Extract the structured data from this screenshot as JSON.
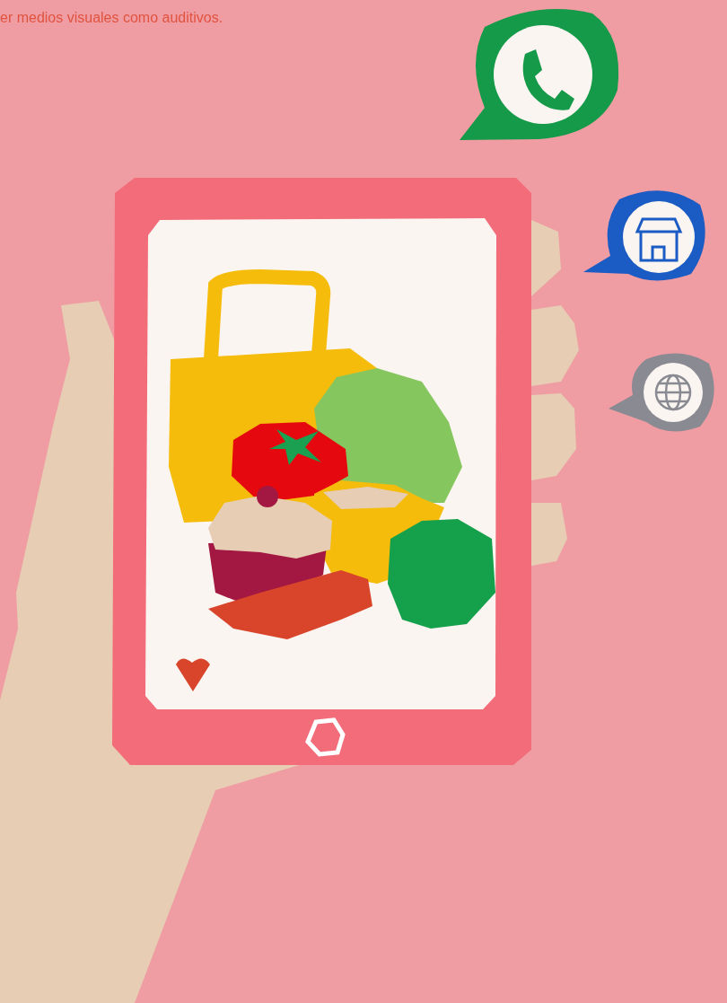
{
  "intro_text": "er medios visuales como auditivos."
}
